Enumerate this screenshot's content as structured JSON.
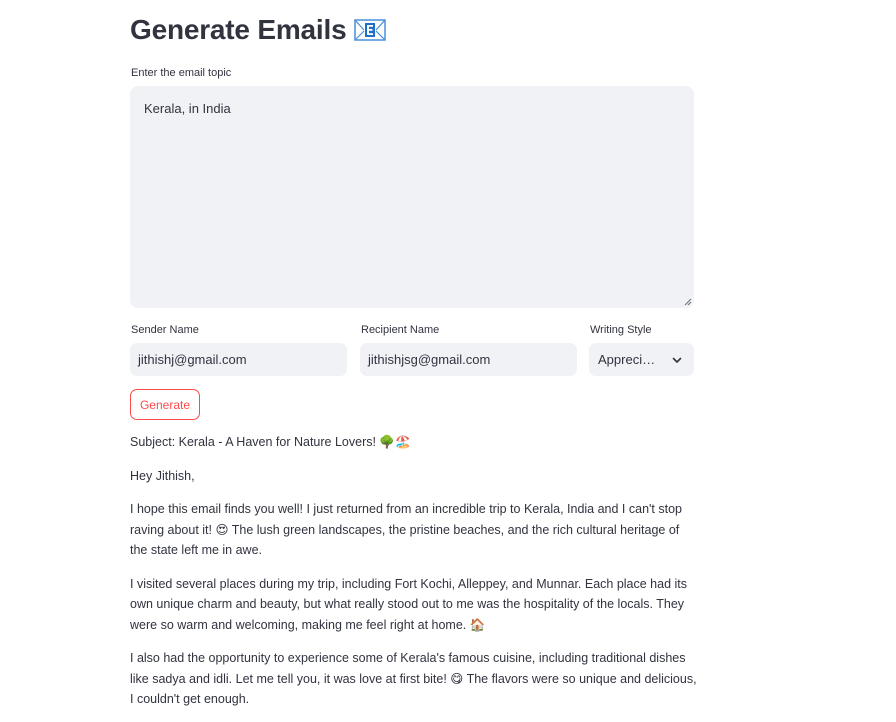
{
  "header": {
    "title": "Generate Emails",
    "title_icon": "e-mail-icon"
  },
  "topic": {
    "label": "Enter the email topic",
    "value": "Kerala, in India"
  },
  "sender": {
    "label": "Sender Name",
    "value": "jithishj@gmail.com"
  },
  "recipient": {
    "label": "Recipient Name",
    "value": "jithishjsg@gmail.com"
  },
  "style": {
    "label": "Writing Style",
    "selected": "Appreci…",
    "icon": "chevron-down-icon"
  },
  "generate_button": {
    "label": "Generate"
  },
  "email": {
    "subject": "Subject: Kerala - A Haven for Nature Lovers! 🌳🏖️",
    "greeting": "Hey Jithish,",
    "paragraphs": [
      "I hope this email finds you well! I just returned from an incredible trip to Kerala, India and I can't stop raving about it! 😍 The lush green landscapes, the pristine beaches, and the rich cultural heritage of the state left me in awe.",
      "I visited several places during my trip, including Fort Kochi, Alleppey, and Munnar. Each place had its own unique charm and beauty, but what really stood out to me was the hospitality of the locals. They were so warm and welcoming, making me feel right at home. 🏠",
      "I also had the opportunity to experience some of Kerala's famous cuisine, including traditional dishes like sadya and idli. Let me tell you, it was love at first bite! 😋 The flavors were so unique and delicious, I couldn't get enough."
    ]
  },
  "colors": {
    "accent": "#ff4b4b",
    "input_bg": "#f0f2f6",
    "text": "#31333f"
  }
}
